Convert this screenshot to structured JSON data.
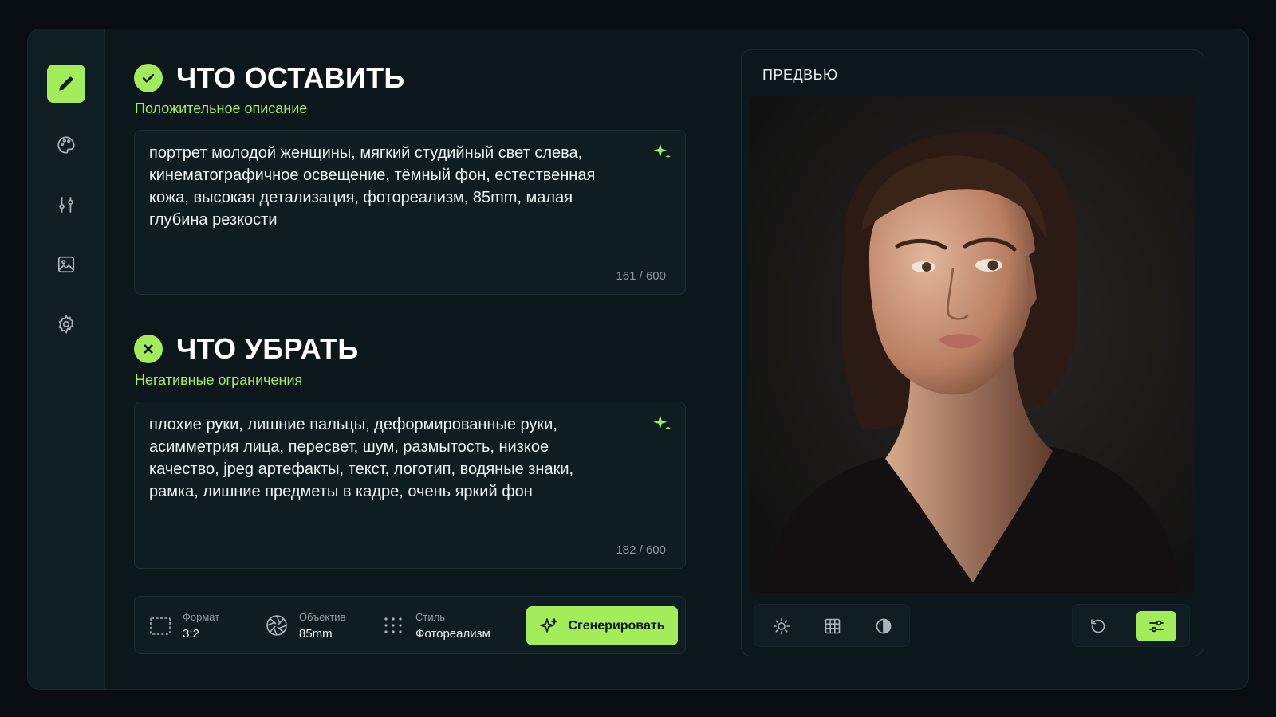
{
  "positive": {
    "title": "ЧТО ОСТАВИТЬ",
    "subtitle": "Положительное описание",
    "text": "портрет молодой женщины, мягкий студийный свет слева, кинематографичное освещение, тёмный фон, естественная кожа, высокая детализация, фотореализм, 85mm, малая глубина резкости",
    "counter": "161 / 600"
  },
  "negative": {
    "title": "ЧТО УБРАТЬ",
    "subtitle": "Негативные ограничения",
    "text": "плохие руки, лишние пальцы, деформированные руки, асимметрия лица, пересвет, шум, размытость, низкое качество, jpeg артефакты, текст, логотип, водяные знаки, рамка, лишние предметы в кадре, очень яркий фон",
    "counter": "182 / 600"
  },
  "toolbar": {
    "format_label": "Формат",
    "format_value": "3:2",
    "lens_label": "Объектив",
    "lens_value": "85mm",
    "style_label": "Стиль",
    "style_value": "Фотореализм",
    "generate_label": "Сгенерировать"
  },
  "preview": {
    "title": "ПРЕДВЬЮ"
  },
  "sidebar": {
    "items": [
      "pencil-icon",
      "palette-icon",
      "sliders-icon",
      "image-icon",
      "gear-icon"
    ],
    "active": "pencil-icon"
  },
  "colors": {
    "accent": "#a3ec5a",
    "background": "#070d11",
    "panel": "#0c171c"
  }
}
